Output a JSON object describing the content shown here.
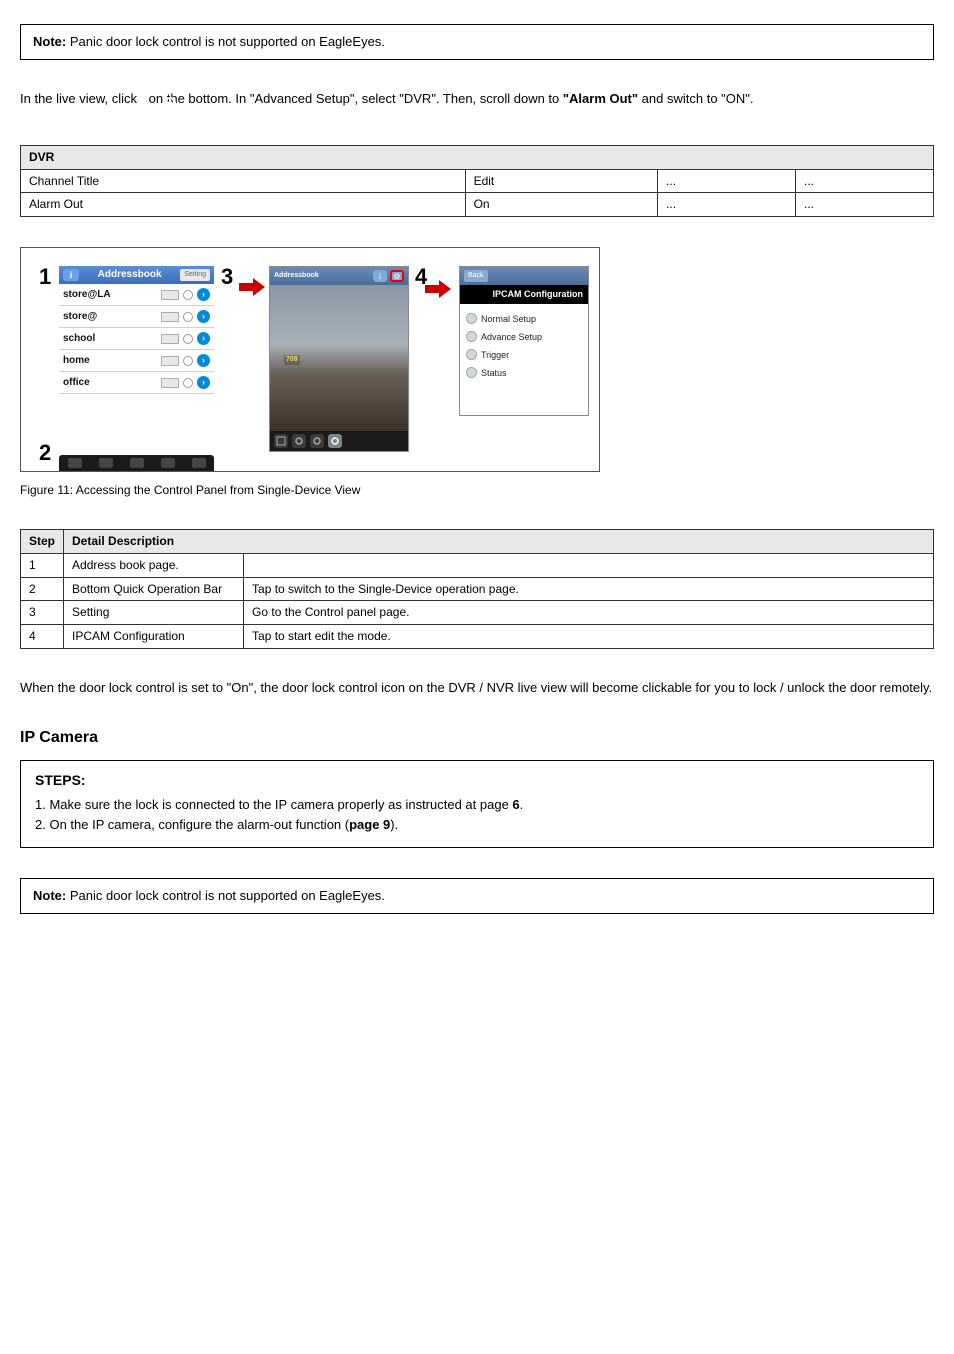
{
  "top_note": {
    "bold": "Note: ",
    "text": "Panic door lock control is not supported on EagleEyes."
  },
  "section_path": {
    "prefix": "In the live view, click ",
    "middle": " on the bottom. In \"Advanced Setup\", select \"DVR\". Then, scroll down to ",
    "bold_item": "\"Alarm Out\"",
    "suffix": " and switch to \"ON\"."
  },
  "table1": {
    "header": "DVR",
    "cells": {
      "r1c1": "Channel Title",
      "r1c2": "Edit",
      "r1c3": "...",
      "r1c4": "...",
      "r2c1": "Alarm Out",
      "r2c2": "On",
      "r2c3": "...",
      "r2c4": "..."
    }
  },
  "addressbook": {
    "info_label": "i",
    "title": "Addressbook",
    "setting_label": "Setting",
    "items": [
      {
        "name": "store@LA"
      },
      {
        "name": "store@"
      },
      {
        "name": "school"
      },
      {
        "name": "home"
      },
      {
        "name": "office"
      }
    ]
  },
  "midpane": {
    "title": "Addressbook",
    "gear_icon": "⚙",
    "overlay": "708"
  },
  "rightpane": {
    "back": "Back",
    "title": "IPCAM Configuration",
    "items": [
      "Normal Setup",
      "Advance Setup",
      "Trigger",
      "Status"
    ]
  },
  "steps": {
    "s1": "1",
    "s2": "2",
    "s3": "3",
    "s4": "4"
  },
  "figure_caption": "Figure 11: Accessing the Control Panel from Single-Device View",
  "table2": {
    "h1": "Step",
    "h2": "Detail Description",
    "rows": [
      {
        "c1": "1",
        "c2": "Address book page.",
        "c3": ""
      },
      {
        "c1": "2",
        "c2": "Bottom Quick Operation Bar",
        "c3": "Tap to switch to the Single-Device operation page."
      },
      {
        "c1": "3",
        "c2": "Setting",
        "c3": "Go to the Control panel page."
      },
      {
        "c1": "4",
        "c2": "IPCAM Configuration",
        "c3": "Tap to start edit the mode."
      }
    ]
  },
  "paragraph": "When the door lock control is set to \"On\", the door lock control icon on the DVR / NVR live view will become clickable for you to lock / unlock the door remotely.",
  "heading_ip": "IP Camera",
  "steps_box": {
    "title": "STEPS:",
    "line1_pre": "1. Make sure the lock is connected to the IP camera properly as instructed at page ",
    "line1_link": "6",
    "line1_post": ".",
    "line2_pre": "2. On the IP camera, configure the alarm-out function (",
    "line2_link": "page 9",
    "line2_post": ")."
  },
  "footer": {
    "bold": "Note: ",
    "text": "Panic door lock control is not supported on EagleEyes."
  }
}
